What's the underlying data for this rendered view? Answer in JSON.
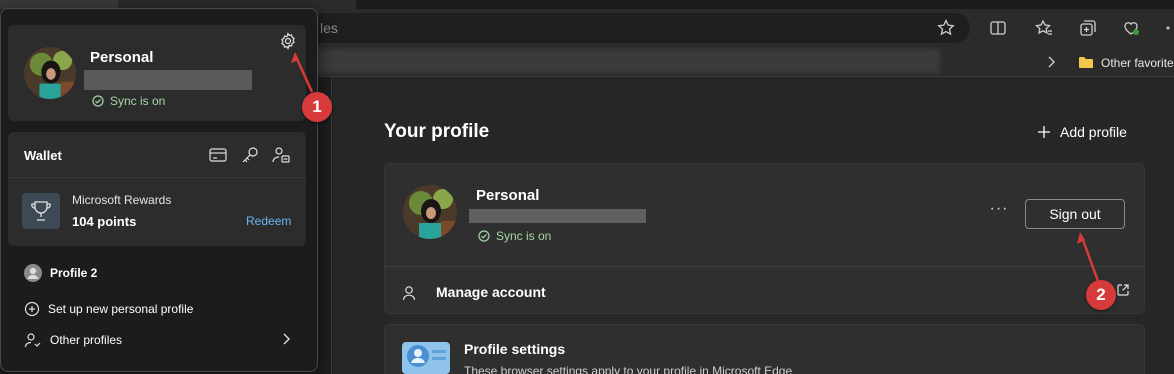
{
  "browser": {
    "address_text": "les",
    "favorites_folder_label": "Other favorite"
  },
  "settings_page": {
    "title": "Your profile",
    "add_profile_label": "Add profile",
    "profile_card": {
      "name": "Personal",
      "sync_status": "Sync is on",
      "more_label": "···",
      "sign_out_label": "Sign out",
      "manage_account_label": "Manage account"
    },
    "profile_settings": {
      "title": "Profile settings",
      "description": "These browser settings apply to your profile in Microsoft Edge"
    }
  },
  "flyout": {
    "profile_name": "Personal",
    "sync_status": "Sync is on",
    "wallet_title": "Wallet",
    "rewards_name": "Microsoft Rewards",
    "rewards_points": "104 points",
    "redeem_label": "Redeem",
    "other_profile_name": "Profile 2",
    "setup_new_label": "Set up new personal profile",
    "other_profiles_label": "Other profiles"
  },
  "annotations": {
    "marker_1": "1",
    "marker_2": "2"
  },
  "colors": {
    "accent_red": "#d73a3a",
    "sync_green": "#a8d5a6",
    "link_blue": "#6cb4f0"
  }
}
